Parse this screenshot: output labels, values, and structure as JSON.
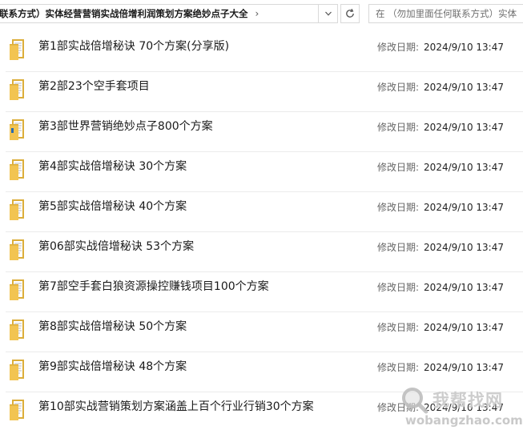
{
  "address_bar": {
    "path_text": "联系方式）实体经营营销实战倍增利润策划方案绝妙点子大全",
    "separator": "›"
  },
  "search": {
    "placeholder": "在 （勿加里面任何联系方式）实体"
  },
  "date_label": "修改日期:",
  "items": [
    {
      "name": "第1部实战倍增秘诀 70个方案(分享版)",
      "date": "2024/9/10 13:47"
    },
    {
      "name": "第2部23个空手套项目",
      "date": "2024/9/10 13:47"
    },
    {
      "name": "第3部世界营销绝妙点子800个方案",
      "date": "2024/9/10 13:47"
    },
    {
      "name": "第4部实战倍增秘诀 30个方案",
      "date": "2024/9/10 13:47"
    },
    {
      "name": "第5部实战倍增秘诀 40个方案",
      "date": "2024/9/10 13:47"
    },
    {
      "name": "第06部实战倍增秘诀 53个方案",
      "date": "2024/9/10 13:47"
    },
    {
      "name": "第7部空手套白狼资源操控赚钱项目100个方案",
      "date": "2024/9/10 13:47"
    },
    {
      "name": "第8部实战倍增秘诀 50个方案",
      "date": "2024/9/10 13:47"
    },
    {
      "name": "第9部实战倍增秘诀  48个方案",
      "date": "2024/9/10 13:47"
    },
    {
      "name": "第10部实战营销策划方案涵盖上百个行业行销30个方案",
      "date": "2024/9/10 13:47"
    }
  ],
  "watermark": {
    "logo_text": "我帮找网",
    "url": "wobangzhao.com"
  },
  "colors": {
    "folder": "#f2c451",
    "folder_dark": "#dcae3a",
    "divider": "#ebebeb"
  }
}
